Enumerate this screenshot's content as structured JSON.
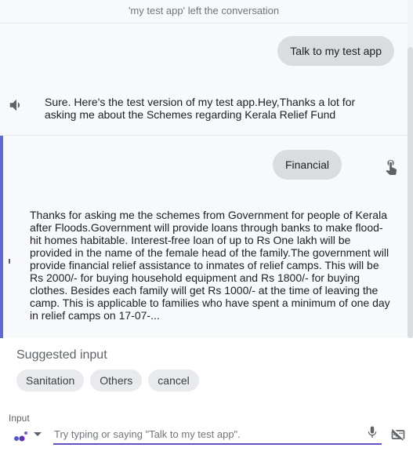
{
  "conversation": {
    "system_note": "'my test app' left the conversation",
    "turns": [
      {
        "user": "Talk to my test app",
        "agent": "Sure. Here's the test version of my test app.Hey,Thanks a lot for asking me about the Schemes regarding Kerala Relief Fund"
      },
      {
        "user": "Financial",
        "agent": "Thanks for asking me the schemes from Government for people of Kerala after Floods.Government will provide loans through banks to make flood-hit homes habitable. Interest-free loan of up to Rs One lakh will be provided in the name of the female head of the family.The government will provide financial relief assistance to inmates of relief camps. This will be Rs 2000/- for buying household equipment and Rs 1800/- for buying clothes. Besides each family will get Rs 1000/- at the time of leaving the camp. This is applicable to families who have spent a minimum of one day in relief camps on 17-07-..."
      }
    ]
  },
  "suggestions": {
    "title": "Suggested input",
    "chips": [
      "Sanitation",
      "Others",
      "cancel"
    ]
  },
  "input": {
    "label": "Input",
    "placeholder": "Try typing or saying \"Talk to my test app\"."
  },
  "colors": {
    "accent": "#5e6ad2",
    "input_underline": "#6750c4",
    "bubble": "#dadce0",
    "chip": "#e8eaed"
  },
  "icons": {
    "speaker": "volume-icon",
    "touch": "touch-icon",
    "assistant": "assistant-dots-icon",
    "dropdown": "chevron-down-icon",
    "mic": "mic-icon",
    "keyboard_off": "keyboard-off-icon"
  }
}
